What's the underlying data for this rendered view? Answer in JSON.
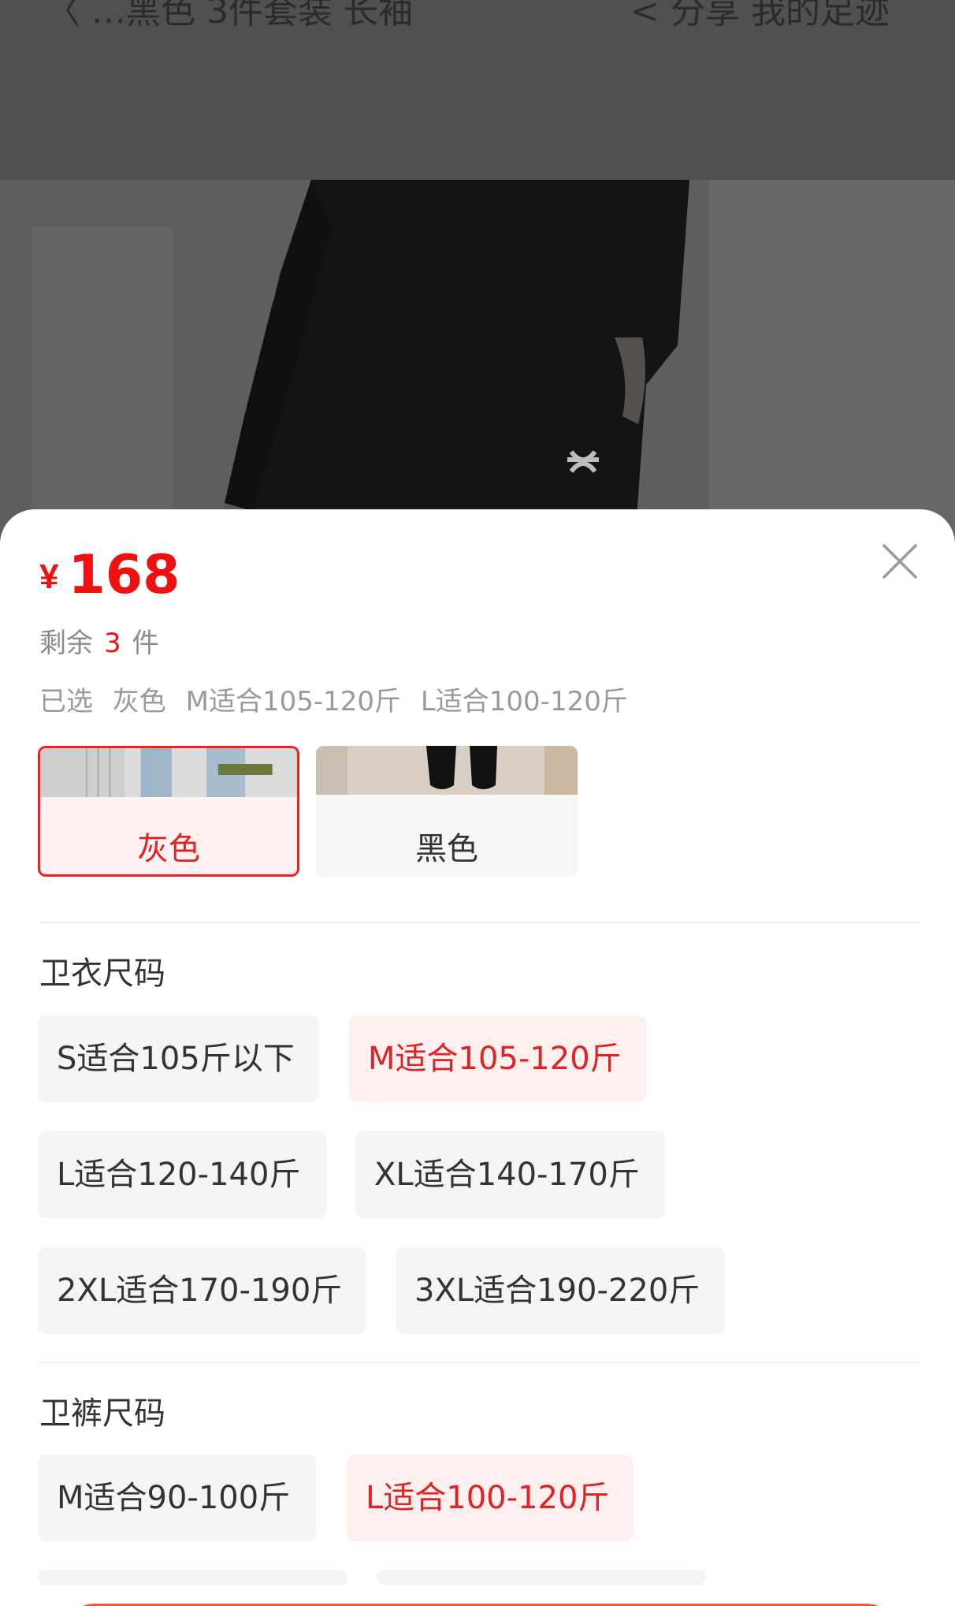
{
  "background_page": {
    "header_left_text": "〈 …黑色 3件套装 长袖",
    "header_right_text": "< 分享   我的足迹"
  },
  "sheet": {
    "price": {
      "currency": "¥",
      "amount": "168"
    },
    "stock": {
      "prefix": "剩余",
      "count": "3",
      "suffix": "件"
    },
    "selected": {
      "prefix": "已选",
      "values": [
        "灰色",
        "M适合105-120斤",
        "L适合100-120斤"
      ]
    },
    "colors": [
      {
        "label": "灰色",
        "selected": true
      },
      {
        "label": "黑色",
        "selected": false
      }
    ],
    "hoodie_size": {
      "title": "卫衣尺码",
      "options": [
        {
          "label": "S适合105斤以下",
          "selected": false
        },
        {
          "label": "M适合105-120斤",
          "selected": true
        },
        {
          "label": "L适合120-140斤",
          "selected": false
        },
        {
          "label": "XL适合140-170斤",
          "selected": false
        },
        {
          "label": "2XL适合170-190斤",
          "selected": false
        },
        {
          "label": "3XL适合190-220斤",
          "selected": false
        }
      ]
    },
    "pants_size": {
      "title": "卫裤尺码",
      "options": [
        {
          "label": "M适合90-100斤",
          "selected": false
        },
        {
          "label": "L适合100-120斤",
          "selected": true
        }
      ]
    },
    "colors_theme": {
      "accent": "#ee1111",
      "selected_bg": "#fff0f0",
      "chip_bg": "#f5f5f5"
    },
    "icons": {
      "close": "close-icon"
    }
  }
}
